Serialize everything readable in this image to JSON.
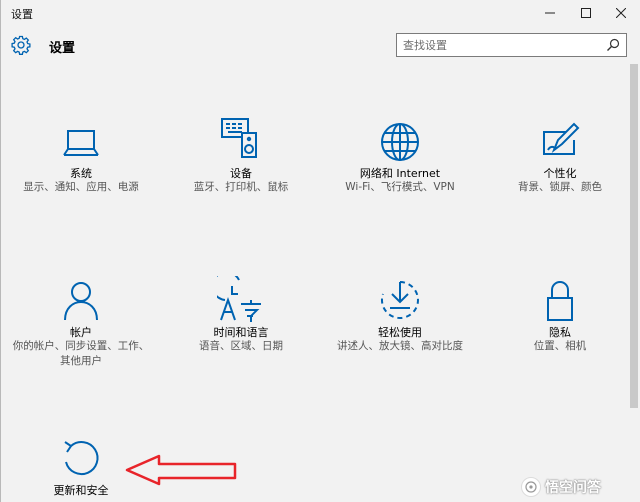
{
  "window": {
    "title": "设置"
  },
  "header": {
    "title": "设置",
    "search_placeholder": "查找设置"
  },
  "tiles": [
    {
      "title": "系统",
      "desc": "显示、通知、应用、电源",
      "icon": "laptop-icon"
    },
    {
      "title": "设备",
      "desc": "蓝牙、打印机、鼠标",
      "icon": "devices-icon"
    },
    {
      "title": "网络和 Internet",
      "desc": "Wi-Fi、飞行模式、VPN",
      "icon": "globe-icon"
    },
    {
      "title": "个性化",
      "desc": "背景、锁屏、颜色",
      "icon": "personalize-icon"
    },
    {
      "title": "帐户",
      "desc": "你的帐户、同步设置、工作、其他用户",
      "icon": "person-icon"
    },
    {
      "title": "时间和语言",
      "desc": "语音、区域、日期",
      "icon": "time-language-icon"
    },
    {
      "title": "轻松使用",
      "desc": "讲述人、放大镜、高对比度",
      "icon": "ease-of-access-icon"
    },
    {
      "title": "隐私",
      "desc": "位置、相机",
      "icon": "lock-icon"
    },
    {
      "title": "更新和安全",
      "desc": "",
      "icon": "update-icon"
    }
  ],
  "watermark": "悟空问答",
  "colors": {
    "accent": "#0063b1",
    "arrow": "#e8242a",
    "background": "#f2f2f2"
  }
}
